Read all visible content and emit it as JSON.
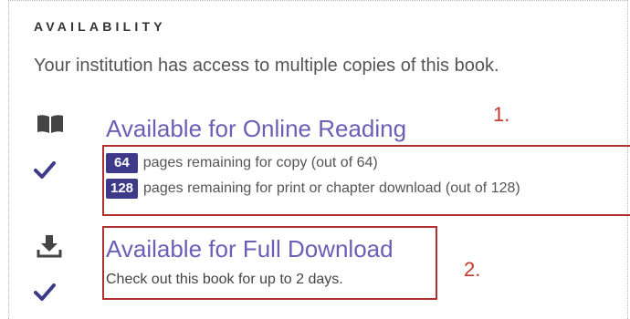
{
  "section": {
    "heading": "AVAILABILITY",
    "intro": "Your institution has access to multiple copies of this book."
  },
  "online_reading": {
    "title": "Available for Online Reading",
    "icon": "book-icon",
    "copy_pages": "64",
    "copy_text": "pages remaining for copy (out of 64)",
    "print_pages": "128",
    "print_text": "pages remaining for print or chapter download (out of 128)"
  },
  "full_download": {
    "title": "Available for Full Download",
    "icon": "download-icon",
    "description": "Check out this book for up to 2 days."
  },
  "annotations": {
    "one": "1.",
    "two": "2."
  },
  "colors": {
    "link": "#6a5fb5",
    "badge": "#3d3a8a",
    "highlight": "#b03030",
    "annotation": "#c0392b"
  }
}
